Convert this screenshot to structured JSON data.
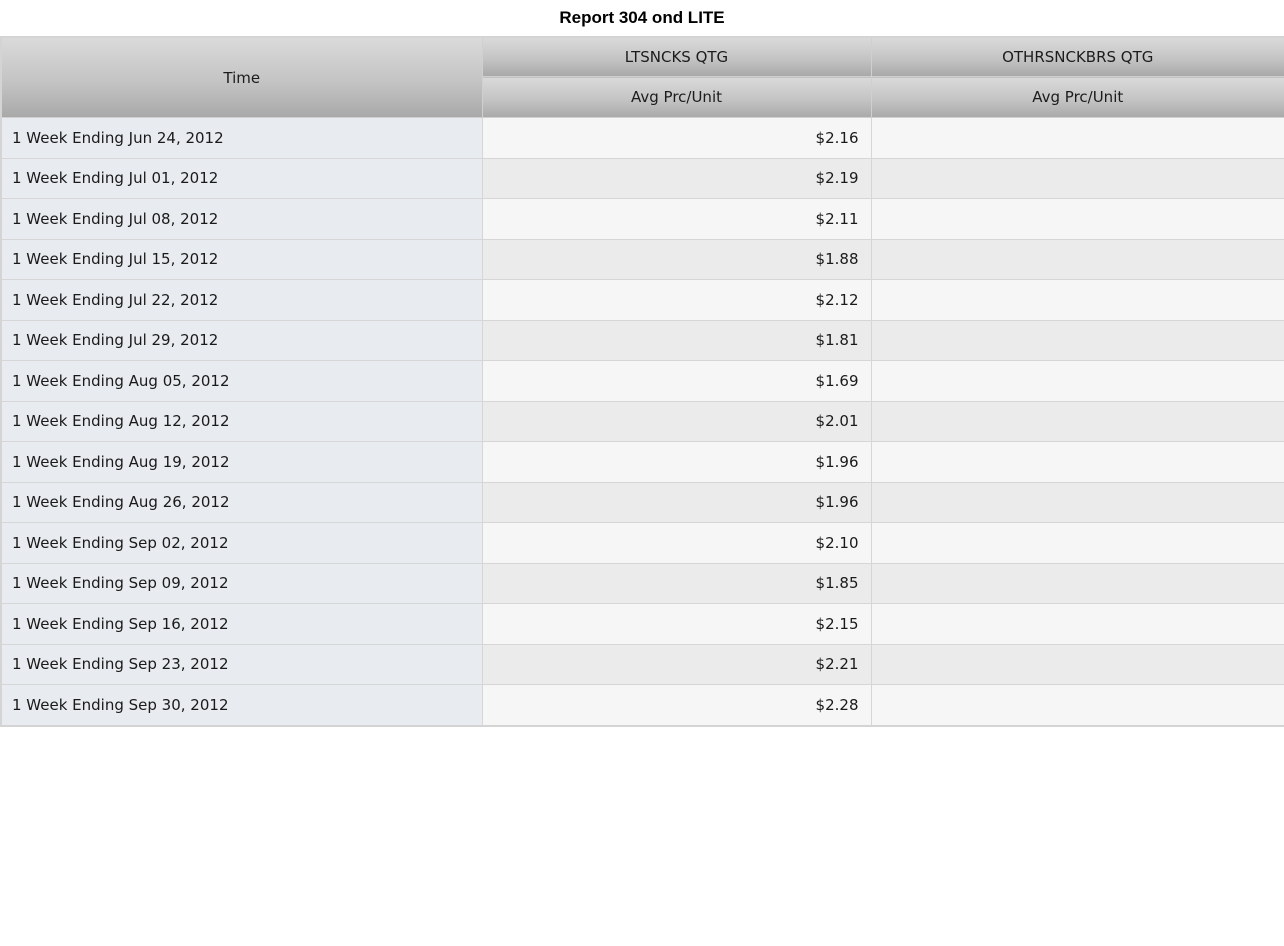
{
  "report": {
    "title": "Report 304 ond LITE"
  },
  "table": {
    "row_header": "Time",
    "columns": [
      {
        "group": "LTSNCKS QTG",
        "measure": "Avg Prc/Unit"
      },
      {
        "group": "OTHRSNCKBRS QTG",
        "measure": "Avg Prc/Unit"
      }
    ],
    "rows": [
      {
        "time": "1 Week Ending Jun 24, 2012",
        "values": [
          "$2.16",
          ""
        ]
      },
      {
        "time": "1 Week Ending Jul 01, 2012",
        "values": [
          "$2.19",
          ""
        ]
      },
      {
        "time": "1 Week Ending Jul 08, 2012",
        "values": [
          "$2.11",
          ""
        ]
      },
      {
        "time": "1 Week Ending Jul 15, 2012",
        "values": [
          "$1.88",
          ""
        ]
      },
      {
        "time": "1 Week Ending Jul 22, 2012",
        "values": [
          "$2.12",
          ""
        ]
      },
      {
        "time": "1 Week Ending Jul 29, 2012",
        "values": [
          "$1.81",
          ""
        ]
      },
      {
        "time": "1 Week Ending Aug 05, 2012",
        "values": [
          "$1.69",
          ""
        ]
      },
      {
        "time": "1 Week Ending Aug 12, 2012",
        "values": [
          "$2.01",
          ""
        ]
      },
      {
        "time": "1 Week Ending Aug 19, 2012",
        "values": [
          "$1.96",
          ""
        ]
      },
      {
        "time": "1 Week Ending Aug 26, 2012",
        "values": [
          "$1.96",
          ""
        ]
      },
      {
        "time": "1 Week Ending Sep 02, 2012",
        "values": [
          "$2.10",
          ""
        ]
      },
      {
        "time": "1 Week Ending Sep 09, 2012",
        "values": [
          "$1.85",
          ""
        ]
      },
      {
        "time": "1 Week Ending Sep 16, 2012",
        "values": [
          "$2.15",
          ""
        ]
      },
      {
        "time": "1 Week Ending Sep 23, 2012",
        "values": [
          "$2.21",
          ""
        ]
      },
      {
        "time": "1 Week Ending Sep 30, 2012",
        "values": [
          "$2.28",
          ""
        ]
      }
    ]
  }
}
